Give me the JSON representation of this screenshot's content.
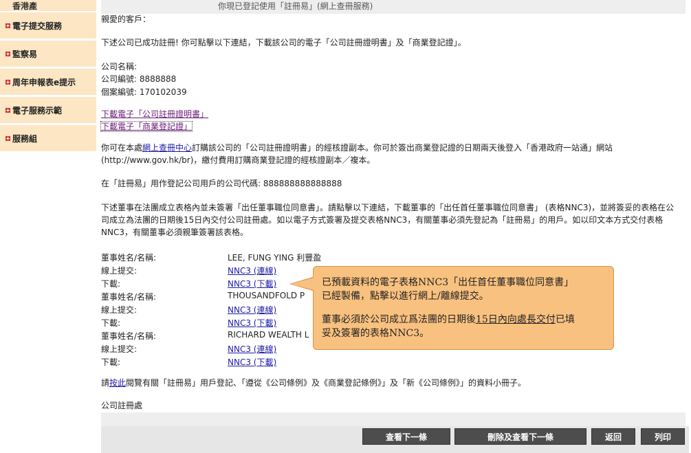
{
  "sidebar": {
    "top_label": "香港產",
    "items": [
      {
        "label": "電子提交服務"
      },
      {
        "label": "監察易"
      },
      {
        "label": "周年申報表e提示"
      },
      {
        "label": "電子服務示範"
      },
      {
        "label": "服務組"
      }
    ]
  },
  "header": {
    "strip_text": "你現已登記使用「註冊易」(網上查冊服務)"
  },
  "content": {
    "greeting": "親愛的客戶：",
    "intro": "下述公司已成功註冊! 你可點擊以下連結，下載該公司的電子「公司註冊證明書」及「商業登記證」。",
    "company_name_label": "公司名稱:",
    "company_no_label": "公司編號:",
    "company_no": "8888888",
    "file_no_label": "個案編號:",
    "file_no": "170102039",
    "download_cert": "下載電子「公司註冊證明書」",
    "download_br": "下載電子「商業登記證」",
    "order_pre": "你可在本處",
    "order_link": "網上查冊中心",
    "order_post": "訂購該公司的「公司註冊證明書」的經核證副本。你可於簽出商業登記證的日期兩天後登入「香港政府一站通」網站",
    "order_line2": "(http://www.gov.hk/br)，繳付費用訂購商業登記證的經核證副本／複本。",
    "code_label": "在「註冊易」用作登記公司用戶的公司代碼:",
    "code_value": "888888888888888",
    "nnc3_para": "下述董事在法團成立表格內並未簽署「出任董事職位同意書」。請點擊以下連結，下載董事的「出任首任董事職位同意書」 (表格NNC3)，並將簽妥的表格在公司成立為法團的日期後15日內交付公司註冊處。如以電子方式簽署及提交表格NNC3，有關董事必須先登記為「註冊易」的用戶。如以印文本方式交付表格NNC3，有關董事必須親筆簽署該表格。",
    "director_label": "董事姓名/名稱:",
    "online_label": "線上提交:",
    "download_label": "下載:",
    "online_link": "NNC3 (連線)",
    "download_link": "NNC3 (下載)",
    "directors": [
      {
        "name": "LEE, FUNG YING 利豐盈"
      },
      {
        "name": "THOUSANDFOLD P"
      },
      {
        "name": "RICHARD WEALTH L"
      }
    ],
    "booklet_pre": "請",
    "booklet_link": "按此",
    "booklet_post": "閱覽有關「註冊易」用戶登記、「遵從《公司條例》及《商業登記條例》」及「新《公司條例》」的資料小冊子。",
    "signature": "公司註冊處"
  },
  "tooltip": {
    "line1": "已預載資料的電子表格NNC3「出任首任董事職位同意書」",
    "line2": "已經製備，點擊以進行網上/離線提交。",
    "line3_pre": "董事必須於公司成立爲法團的日期後",
    "line3_u": "15日內向處長交付",
    "line3_post": "已填",
    "line4": "妥及簽署的表格NNC3。"
  },
  "buttons": {
    "next": "查看下一條",
    "delete_next": "刪除及查看下一條",
    "back": "返回",
    "print": "列印"
  }
}
